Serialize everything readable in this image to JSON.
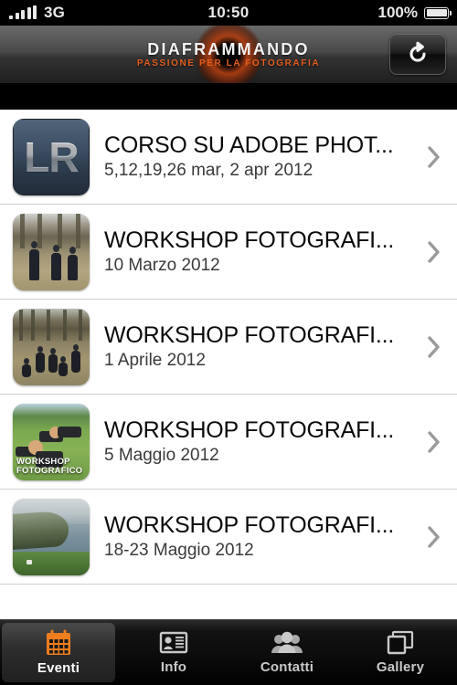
{
  "status_bar": {
    "carrier": "3G",
    "time": "10:50",
    "battery_pct": "100%",
    "signal_icon": "signal-bars-icon",
    "battery_icon": "battery-full-icon"
  },
  "nav_bar": {
    "logo_title": "DIAFRAMMANDO",
    "logo_subtitle": "PASSIONE PER LA FOTOGRAFIA",
    "refresh_icon": "refresh-icon",
    "accent_color": "#e35d1e"
  },
  "events": [
    {
      "title": "CORSO SU ADOBE PHOT...",
      "date": "5,12,19,26 mar, 2 apr 2012",
      "thumb": "lightroom-icon",
      "thumb_label": "LR"
    },
    {
      "title": "WORKSHOP FOTOGRAFI...",
      "date": "10 Marzo 2012",
      "thumb": "photo-people-walking"
    },
    {
      "title": "WORKSHOP FOTOGRAFI...",
      "date": "1 Aprile 2012",
      "thumb": "photo-group-field"
    },
    {
      "title": "WORKSHOP FOTOGRAFI...",
      "date": "5 Maggio 2012",
      "thumb": "photo-green-field",
      "thumb_caption": "WORKSHOP FOTOGRAFICO"
    },
    {
      "title": "WORKSHOP FOTOGRAFI...",
      "date": "18-23 Maggio 2012",
      "thumb": "photo-coastline"
    }
  ],
  "tab_bar": {
    "items": [
      {
        "label": "Eventi",
        "icon": "calendar-icon",
        "active": true
      },
      {
        "label": "Info",
        "icon": "contact-card-icon",
        "active": false
      },
      {
        "label": "Contatti",
        "icon": "people-icon",
        "active": false
      },
      {
        "label": "Gallery",
        "icon": "photos-icon",
        "active": false
      }
    ],
    "active_color": "#ed7d1e",
    "inactive_color": "#c9c9c9"
  }
}
